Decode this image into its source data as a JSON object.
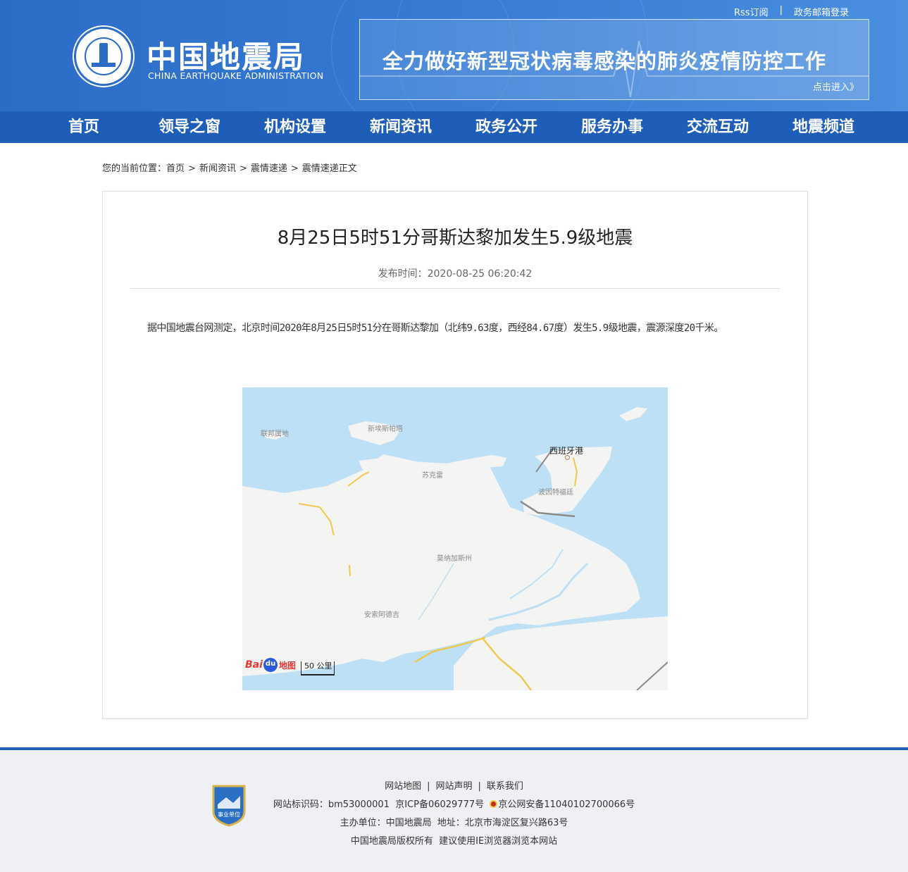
{
  "header": {
    "logo_cn": "中国地震局",
    "logo_en": "CHINA EARTHQUAKE ADMINISTRATION",
    "top_links": [
      "Rss订阅",
      "政务邮箱登录"
    ],
    "top_sep": "|",
    "banner_title": "全力做好新型冠状病毒感染的肺炎疫情防控工作",
    "banner_link": "点击进入》"
  },
  "nav": {
    "items": [
      "首页",
      "领导之窗",
      "机构设置",
      "新闻资讯",
      "政务公开",
      "服务办事",
      "交流互动",
      "地震频道"
    ]
  },
  "breadcrumb": {
    "prefix": "您的当前位置：",
    "items": [
      "首页",
      "新闻资讯",
      "震情速递",
      "震情速递正文"
    ],
    "arrow": ">"
  },
  "article": {
    "title": "8月25日5时51分哥斯达黎加发生5.9级地震",
    "pub_label": "发布时间：",
    "pub_time": "2020-08-25 06:20:42",
    "body": "据中国地震台网测定，北京时间2020年8月25日5时51分在哥斯达黎加（北纬9.63度，西经84.67度）发生5.9级地震，震源深度20千米。"
  },
  "map": {
    "labels": [
      "联邦属地",
      "新埃斯帕塔",
      "苏克雷",
      "西班牙港",
      "波因特福廷",
      "莫纳加斯州",
      "安索阿德吉"
    ],
    "scale_label": "50 公里",
    "baidu_bai": "Bai",
    "baidu_ditu": "地图"
  },
  "footer": {
    "links": [
      "网站地图",
      "网站声明",
      "联系我们"
    ],
    "link_sep": "|",
    "badge_text": "事业单位",
    "site_id": "网站标识码：bm53000001",
    "icp": "京ICP备06029777号",
    "police": "京公网安备11040102700066号",
    "sponsor": "主办单位：中国地震局",
    "address": "地址：北京市海淀区复兴路63号",
    "copyright": "中国地震局版权所有",
    "browser_tip": "建议使用IE浏览器浏览本网站"
  },
  "colors": {
    "header_blue": "#2b6cc6",
    "nav_blue": "#1e5eb8",
    "footer_bg": "#eef0f3",
    "map_sea": "#bde0f6"
  }
}
